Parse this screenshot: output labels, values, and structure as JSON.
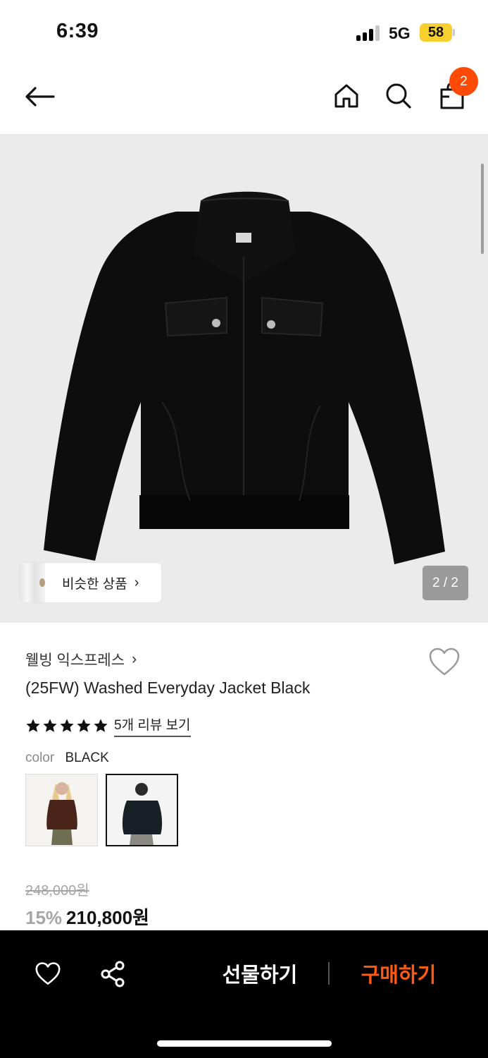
{
  "status_bar": {
    "time": "6:39",
    "network": "5G",
    "battery": "58"
  },
  "header": {
    "back_icon": "arrow-left-icon",
    "home_icon": "home-icon",
    "search_icon": "search-icon",
    "cart_icon": "shopping-bag-icon",
    "cart_count": "2"
  },
  "gallery": {
    "similar_label": "비슷한 상품",
    "similar_arrow": "›",
    "page_counter": "2 / 2"
  },
  "product": {
    "brand": "웰빙 익스프레스",
    "brand_arrow": "›",
    "title": "(25FW) Washed Everyday Jacket Black",
    "rating_stars": 5,
    "review_link": "5개 리뷰 보기",
    "color_key": "color",
    "color_value": "BLACK",
    "original_price": "248,000원",
    "discount": "15%",
    "sale_price": "210,800원"
  },
  "bottom_bar": {
    "gift_label": "선물하기",
    "buy_label": "구매하기"
  },
  "colors": {
    "accent": "#ff4a06",
    "buy": "#ff5a13",
    "battery": "#f7cf2f",
    "gallery_bg": "#ebebeb"
  }
}
